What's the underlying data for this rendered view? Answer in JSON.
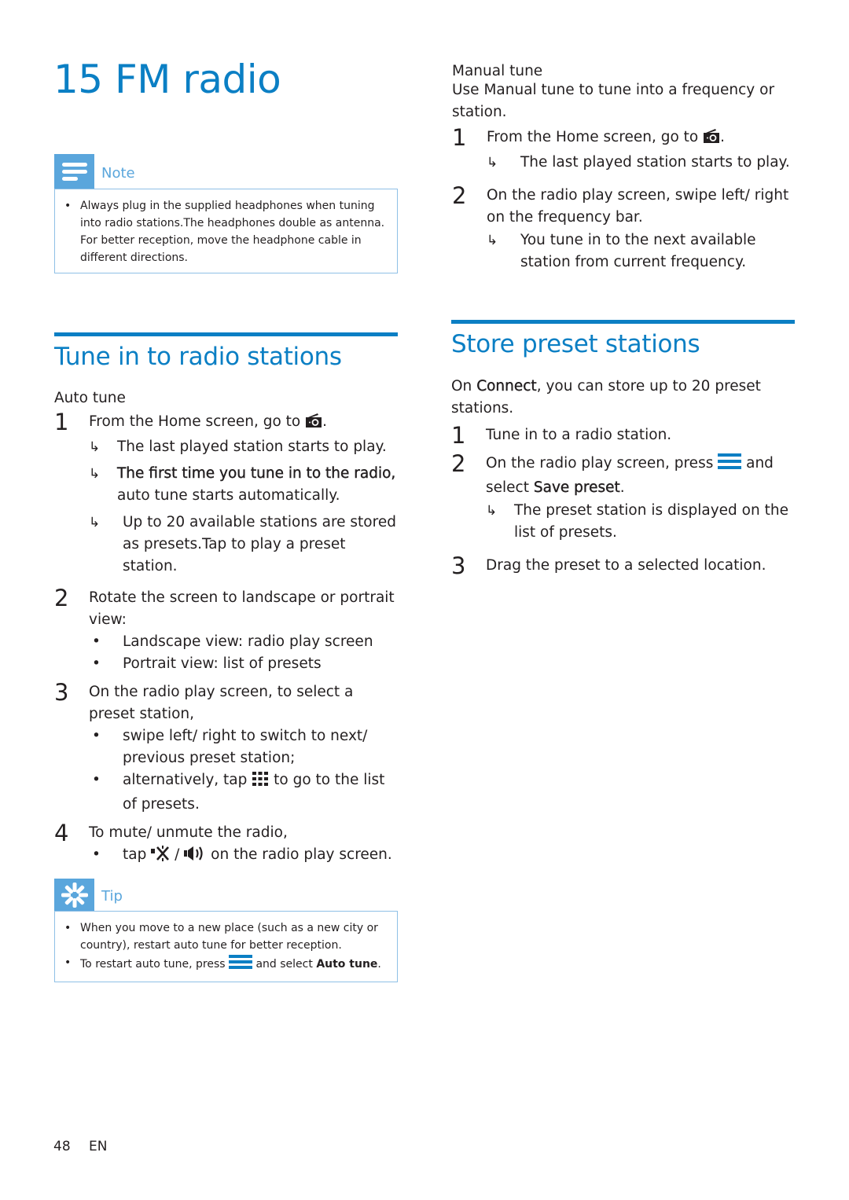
{
  "chapter": {
    "number": "15",
    "title": "FM radio"
  },
  "note": {
    "label": "Note",
    "icon": "note-lines-icon",
    "items": [
      "Always plug in the supplied headphones when tuning into radio stations.The headphones double as antenna. For better reception, move the headphone cable in different directions."
    ]
  },
  "tune_section": {
    "title": "Tune in to radio stations",
    "auto_tune": {
      "heading": "Auto tune",
      "steps": [
        {
          "num": "1",
          "text": "From the Home screen, go to",
          "icon": "radio-icon",
          "suffix": ".",
          "results": [
            {
              "text": "The last played station starts to play."
            },
            {
              "bold": "The first time you tune in to the radio,",
              "text": " auto tune starts automatically."
            },
            {
              "text": "Up to 20 available stations are stored as presets.Tap to play a preset station."
            }
          ]
        },
        {
          "num": "2",
          "text": "Rotate the screen to landscape or portrait view:",
          "bullets": [
            "Landscape view: radio play screen",
            "Portrait view: list of presets"
          ]
        },
        {
          "num": "3",
          "text": "On the radio play screen, to select a preset station,",
          "bullets": [
            "swipe left/ right to switch to next/ previous preset station;"
          ],
          "bullet_icon": {
            "before": "alternatively, tap",
            "icon": "grid-icon",
            "after": "to go to the list of presets."
          }
        },
        {
          "num": "4",
          "text": "To mute/ unmute the radio,",
          "bullet_mute": {
            "before": "tap",
            "icon1": "mute-icon",
            "sep": "/",
            "icon2": "volume-icon",
            "after": "on the radio play screen."
          }
        }
      ]
    }
  },
  "tip": {
    "label": "Tip",
    "icon": "tip-asterisk-icon",
    "items": [
      {
        "text": "When you move to a new place (such as a new city or country), restart auto tune for better reception."
      },
      {
        "before": "To restart auto tune, press",
        "icon": "menu-icon",
        "after": "and select",
        "bold": "Auto tune",
        "end": "."
      }
    ]
  },
  "manual_tune": {
    "heading": "Manual tune",
    "intro": "Use Manual tune to tune into a frequency or station.",
    "steps": [
      {
        "num": "1",
        "text": "From the Home screen, go to",
        "icon": "radio-icon",
        "suffix": ".",
        "results": [
          "The last played station starts to play."
        ]
      },
      {
        "num": "2",
        "text": "On the radio play screen, swipe left/ right on the frequency bar.",
        "results": [
          "You tune in to the next available station from current frequency."
        ]
      }
    ]
  },
  "store_section": {
    "title": "Store preset stations",
    "intro": {
      "before": "On",
      "bold": "Connect",
      "after": ", you can store up to 20 preset stations."
    },
    "steps": [
      {
        "num": "1",
        "text": "Tune in to a radio station."
      },
      {
        "num": "2",
        "before": "On the radio play screen, press",
        "icon": "menu-icon",
        "after": "and select",
        "bold": "Save preset",
        "end": ".",
        "results": [
          "The preset station is displayed on the list of presets."
        ]
      },
      {
        "num": "3",
        "text": "Drag the preset to a selected location."
      }
    ]
  },
  "footer": {
    "page_number": "48",
    "language": "EN"
  },
  "colors": {
    "accent": "#0b7fc4",
    "callout": "#5aa6dc",
    "callout_border": "#8fc0e6",
    "text": "#231f20"
  }
}
